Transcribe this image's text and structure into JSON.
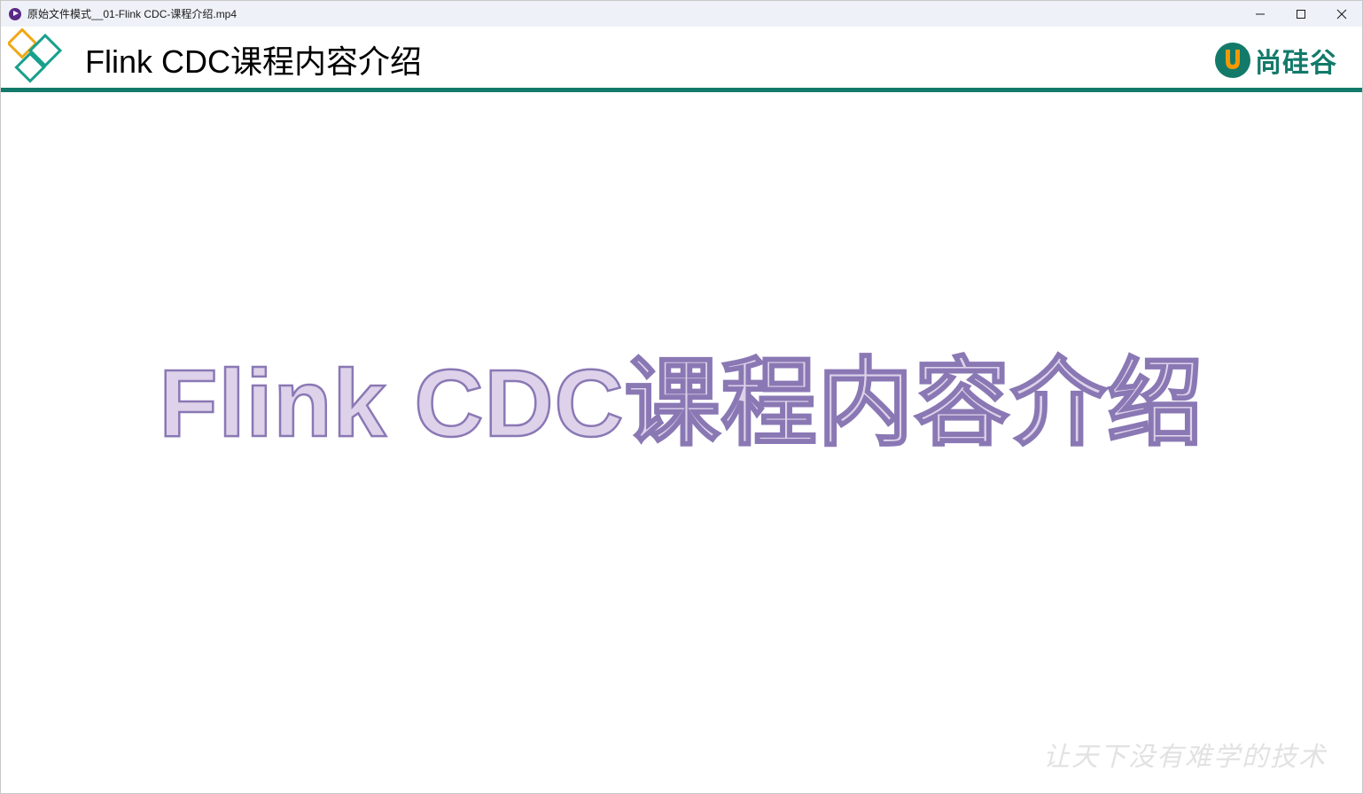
{
  "window": {
    "title": "原始文件模式__01-Flink CDC-课程介绍.mp4",
    "icon": "media-player-icon",
    "controls": {
      "minimize": "minimize-icon",
      "maximize": "maximize-icon",
      "close": "close-icon"
    }
  },
  "slide": {
    "header_title": "Flink CDC课程内容介绍",
    "brand_name": "尚硅谷",
    "main_title": "Flink CDC课程内容介绍",
    "slogan": "让天下没有难学的技术"
  },
  "colors": {
    "header_rule": "#137a6a",
    "diamond_orange": "#f0a818",
    "diamond_teal": "#17a08c",
    "brand_green": "#137a6a",
    "brand_orange": "#f39800",
    "title_fill": "#ddd2ea",
    "title_stroke": "#8a78b4"
  }
}
